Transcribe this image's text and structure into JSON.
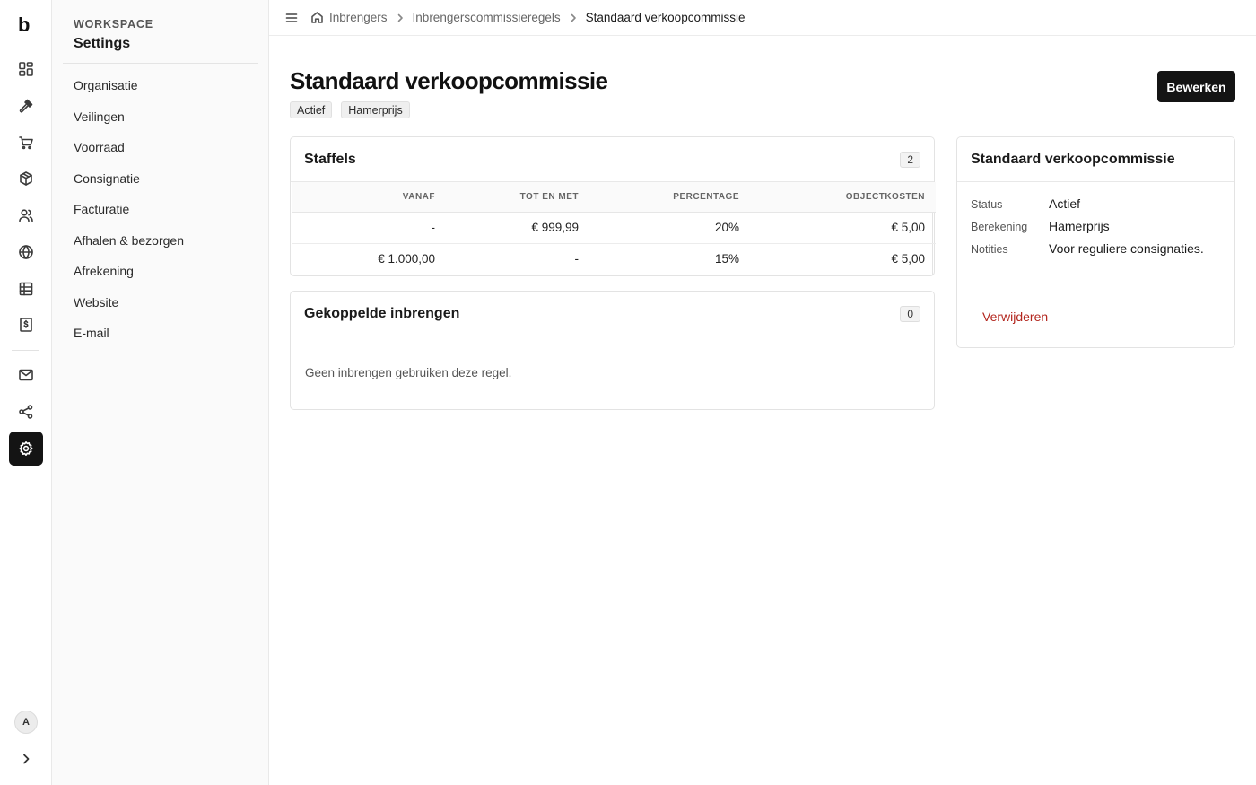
{
  "app": {
    "logo": "b"
  },
  "rail": {
    "icons": [
      "dashboard-icon",
      "gavel-icon",
      "cart-icon",
      "box-icon",
      "users-icon",
      "globe-icon",
      "table-icon",
      "invoice-icon",
      "mail-icon",
      "share-icon",
      "gear-icon"
    ],
    "avatar": "A"
  },
  "settings": {
    "workspace_label": "WORKSPACE",
    "title": "Settings",
    "items": [
      {
        "label": "Organisatie"
      },
      {
        "label": "Veilingen"
      },
      {
        "label": "Voorraad"
      },
      {
        "label": "Consignatie"
      },
      {
        "label": "Facturatie"
      },
      {
        "label": "Afhalen & bezorgen"
      },
      {
        "label": "Afrekening"
      },
      {
        "label": "Website"
      },
      {
        "label": "E-mail"
      }
    ]
  },
  "breadcrumb": [
    "Inbrengers",
    "Inbrengerscommissieregels",
    "Standaard verkoopcommissie"
  ],
  "page": {
    "title": "Standaard verkoopcommissie",
    "badges": [
      "Actief",
      "Hamerprijs"
    ],
    "edit_label": "Bewerken"
  },
  "staffels": {
    "title": "Staffels",
    "count": "2",
    "columns": [
      "VANAF",
      "TOT EN MET",
      "PERCENTAGE",
      "OBJECTKOSTEN"
    ],
    "rows": [
      [
        "-",
        "€ 999,99",
        "20%",
        "€ 5,00"
      ],
      [
        "€ 1.000,00",
        "-",
        "15%",
        "€ 5,00"
      ]
    ]
  },
  "gekoppeld": {
    "title": "Gekoppelde inbrengen",
    "count": "0",
    "empty": "Geen inbrengen gebruiken deze regel."
  },
  "detail": {
    "title": "Standaard verkoopcommissie",
    "fields": [
      {
        "key": "Status",
        "value": "Actief"
      },
      {
        "key": "Berekening",
        "value": "Hamerprijs"
      },
      {
        "key": "Notities",
        "value": "Voor reguliere consignaties."
      }
    ],
    "delete_label": "Verwijderen"
  },
  "colors": {
    "accent": "#141414",
    "danger": "#b3261e"
  }
}
